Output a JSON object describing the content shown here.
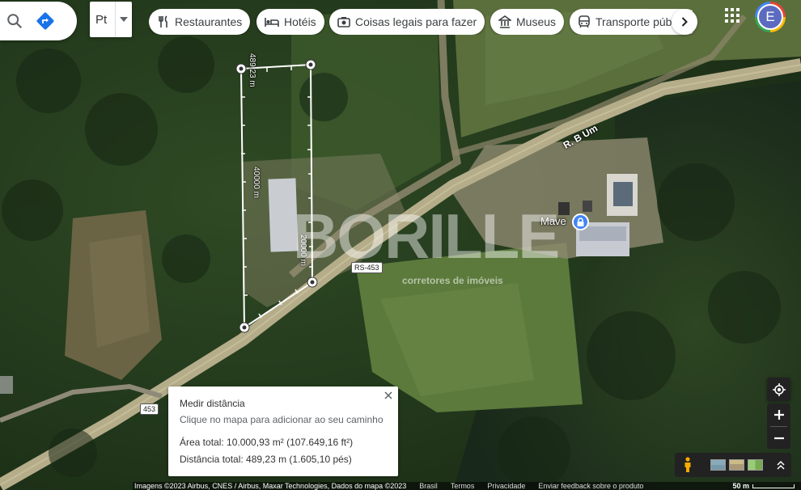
{
  "toolbar": {
    "layer_select_label": "Pt",
    "chips": [
      {
        "label": "Restaurantes",
        "icon": "restaurant-icon"
      },
      {
        "label": "Hotéis",
        "icon": "hotel-icon"
      },
      {
        "label": "Coisas legais para fazer",
        "icon": "camera-icon"
      },
      {
        "label": "Museus",
        "icon": "museum-icon"
      },
      {
        "label": "Transporte público",
        "icon": "transit-icon"
      }
    ],
    "avatar_letter": "E"
  },
  "map": {
    "measurements": {
      "top_edge": "489,23 m",
      "left_edge": "40000 m",
      "right_edge": "20000 m"
    },
    "road_label": "R. B Um",
    "route_shields": [
      "RS-453",
      "453"
    ],
    "place_name": "Mave",
    "watermark_main": "BORILLE",
    "watermark_sub": "corretores de imóveis"
  },
  "measure_card": {
    "title": "Medir distância",
    "hint": "Clique no mapa para adicionar ao seu caminho",
    "area": "Área total: 10.000,93 m² (107.649,16 ft²)",
    "distance": "Distância total: 489,23 m (1.605,10 pés)"
  },
  "footer": {
    "attribution": "Imagens ©2023 Airbus, CNES / Airbus, Maxar Technologies, Dados do mapa ©2023",
    "links": [
      "Brasil",
      "Termos",
      "Privacidade",
      "Enviar feedback sobre o produto"
    ],
    "scale": "50 m"
  },
  "colors": {
    "accent_blue": "#4285f4",
    "directions_blue": "#1a73e8",
    "control_dark": "#222222"
  }
}
